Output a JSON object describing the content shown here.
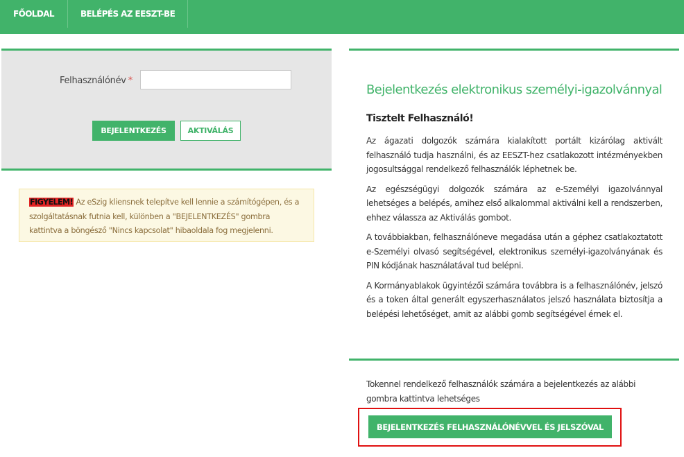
{
  "nav": {
    "items": [
      {
        "label": "FŐOLDAL"
      },
      {
        "label": "BELÉPÉS AZ EESZT-BE"
      }
    ]
  },
  "login": {
    "username_label": "Felhasználónév",
    "required_mark": "*",
    "username_value": "",
    "login_button": "BEJELENTKEZÉS",
    "activate_button": "AKTIVÁLÁS"
  },
  "warning": {
    "tag": "FIGYELEM!",
    "text": " Az eSzig kliensnek telepítve kell lennie a számítógépen, és a szolgáltatásnak futnia kell, különben a \"BEJELENTKEZÉS\" gombra kattintva a böngésző \"Nincs kapcsolat\" hibaoldala fog megjelenni."
  },
  "info": {
    "title": "Bejelentkezés elektronikus személyi-igazolvánnyal",
    "greeting": "Tisztelt Felhasználó!",
    "paragraphs": [
      "Az ágazati dolgozók számára kialakított portált kizárólag aktivált felhasználó tudja használni, és az EESZT-hez csatlakozott intézményekben jogosultsággal rendelkező felhasználók léphetnek be.",
      "Az egészségügyi dolgozók számára az e-Személyi igazolvánnyal lehetséges a belépés, amihez első alkalommal aktiválni kell a rendszerben, ehhez válassza az Aktiválás gombot.",
      "A továbbiakban, felhasználóneve megadása után a géphez csatlakoztatott e-Személyi olvasó segítségével, elektronikus személyi-igazolványának és PIN kódjának használatával tud belépni.",
      "A Kormányablakok ügyintézői számára továbbra is a felhasználónév, jelszó és a token által generált egyszerhasználatos jelszó használata biztosítja a belépési lehetőséget, amit az alábbi gomb segítségével érnek el."
    ]
  },
  "token": {
    "text": "Tokennel rendelkező felhasználók számára a bejelentkezés az alábbi gombra kattintva lehetséges",
    "button": "BEJELENTKEZÉS FELHASZNÁLÓNÉVVEL ÉS JELSZÓVAL"
  },
  "colors": {
    "brand_green": "#41b36a",
    "highlight_red": "#e01010",
    "warning_bg": "#fcf8e3"
  }
}
